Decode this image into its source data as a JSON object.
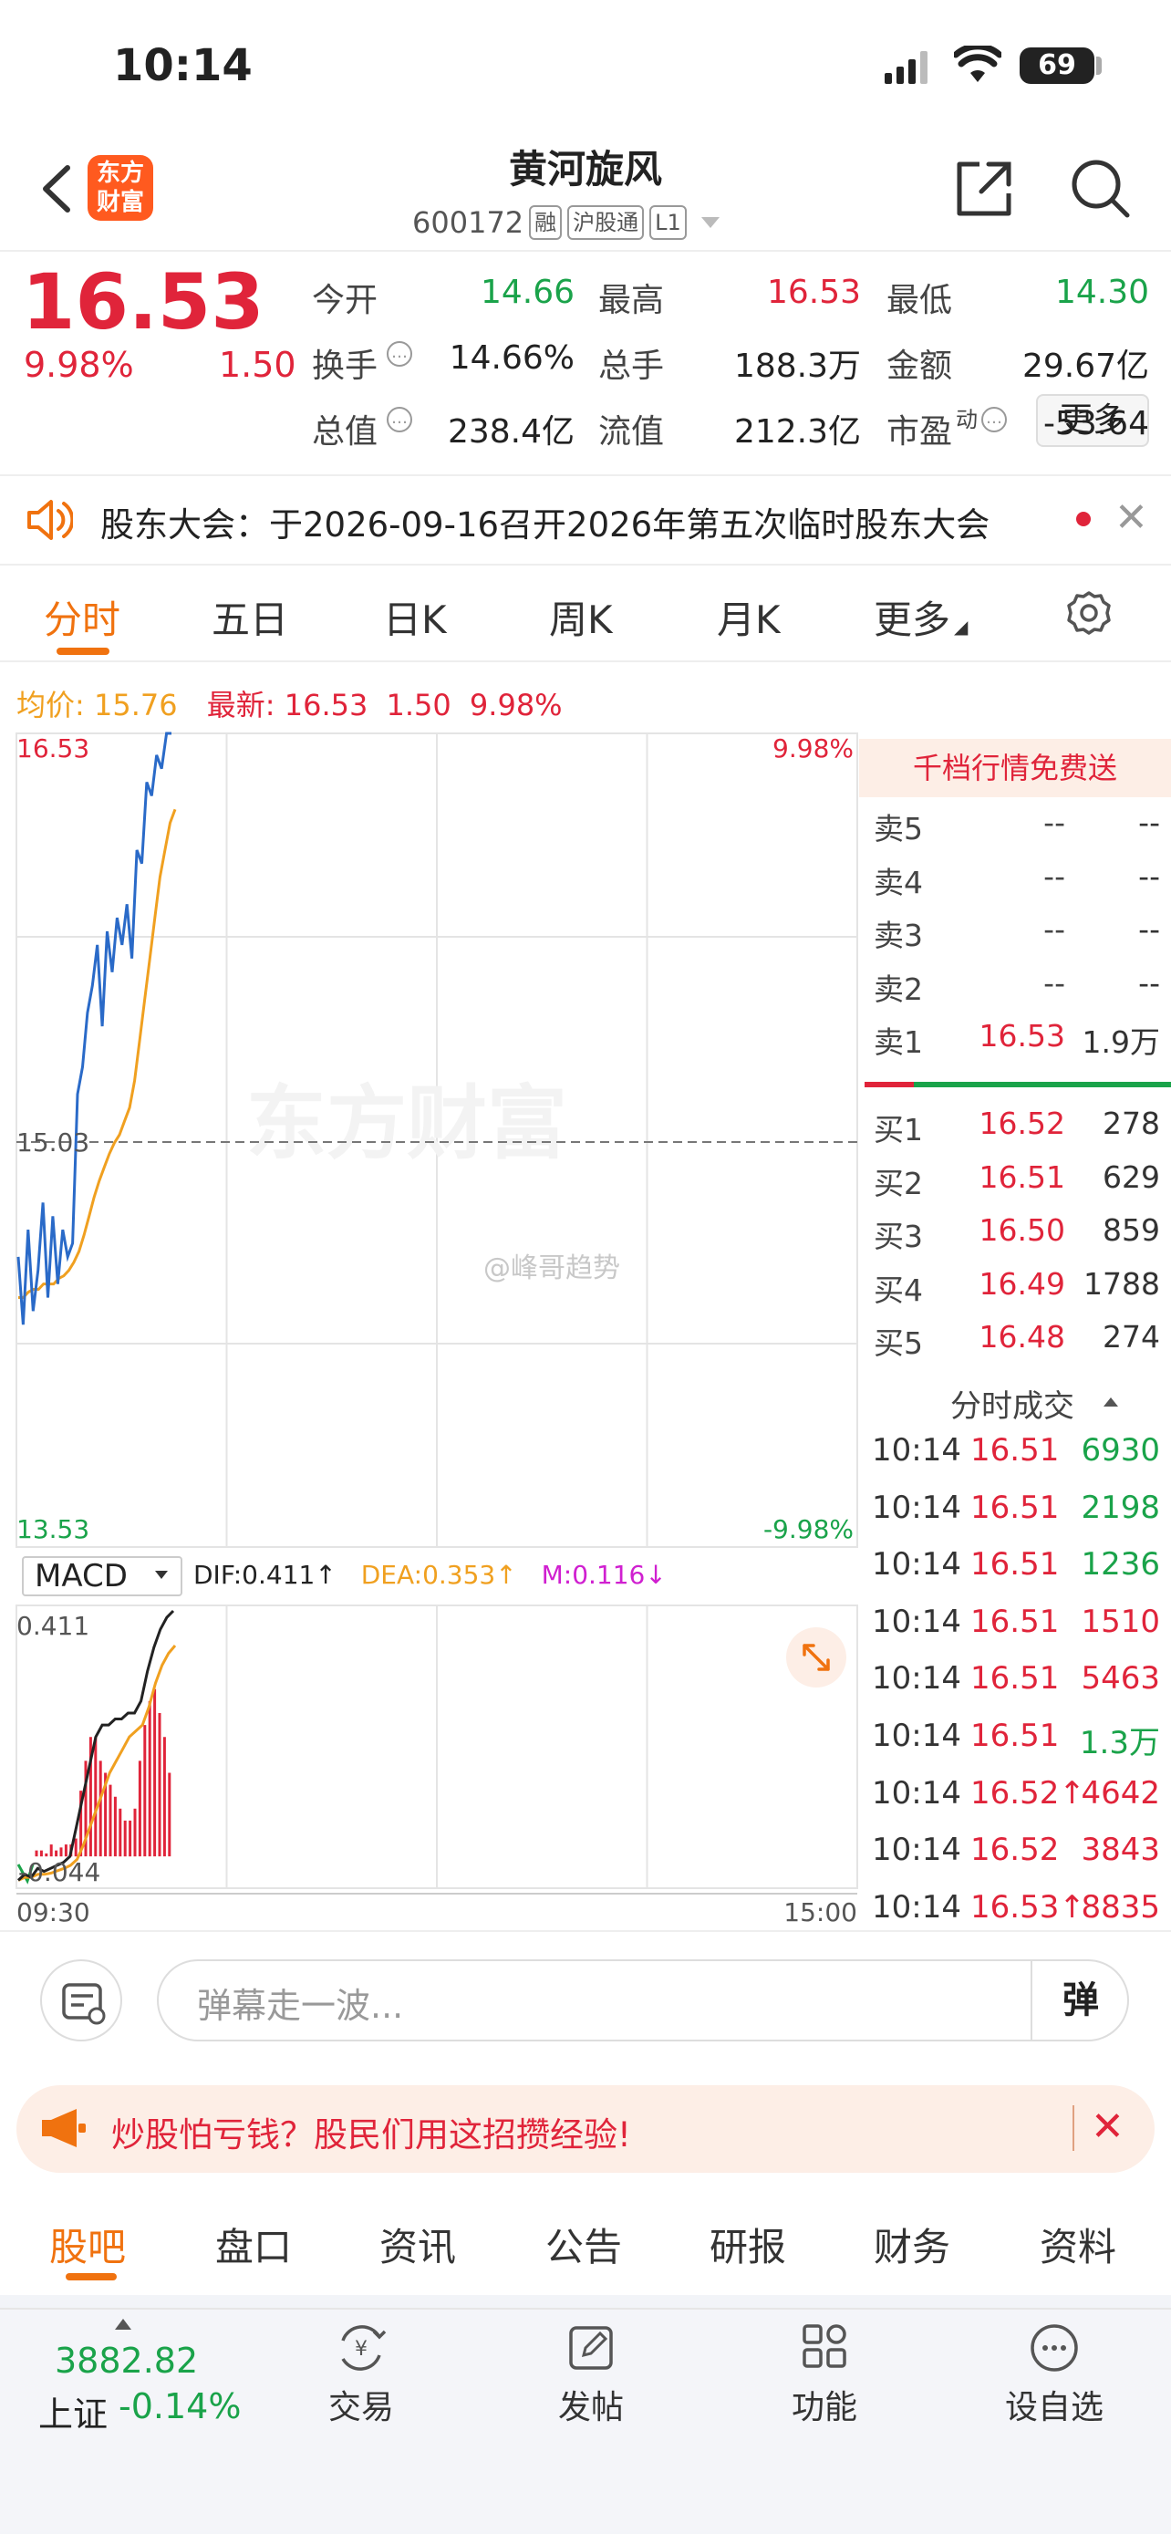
{
  "status": {
    "time": "10:14",
    "battery": "69"
  },
  "header": {
    "logo_line1": "东方",
    "logo_line2": "财富",
    "name": "黄河旋风",
    "code": "600172",
    "tags": [
      "融",
      "沪股通",
      "L1"
    ]
  },
  "quote": {
    "price": "16.53",
    "change_pct": "9.98%",
    "change": "1.50",
    "rows": [
      [
        {
          "label": "今开",
          "value": "14.66",
          "color": "green"
        },
        {
          "label": "最高",
          "value": "16.53",
          "color": "red"
        },
        {
          "label": "最低",
          "value": "14.30",
          "color": "green"
        }
      ],
      [
        {
          "label": "换手",
          "value": "14.66%",
          "color": "dark",
          "info": true
        },
        {
          "label": "总手",
          "value": "188.3万",
          "color": "dark"
        },
        {
          "label": "金额",
          "value": "29.67亿",
          "color": "dark"
        }
      ],
      [
        {
          "label": "总值",
          "value": "238.4亿",
          "color": "dark",
          "info": true
        },
        {
          "label": "流值",
          "value": "212.3亿",
          "color": "dark"
        },
        {
          "label": "市盈",
          "sup": "动",
          "value": "-53.64",
          "color": "dark",
          "info": true
        }
      ]
    ],
    "more_label": "更多"
  },
  "notice": {
    "text": "股东大会：于2026-09-16召开2026年第五次临时股东大会"
  },
  "tabs": [
    "分时",
    "五日",
    "日K",
    "周K",
    "月K",
    "更多"
  ],
  "summary": {
    "avg_label": "均价:",
    "avg_value": "15.76",
    "latest_label": "最新:",
    "latest_value": "16.53",
    "latest_change": "1.50",
    "latest_pct": "9.98%"
  },
  "chart_data": {
    "type": "line",
    "y_top": "16.53",
    "y_mid": "15.03",
    "y_bottom": "13.53",
    "pct_top": "9.98%",
    "pct_bottom": "-9.98%",
    "x_start": "09:30",
    "x_end": "15:00",
    "watermark": "东方财富",
    "weibo_mark": "@峰哥趋势",
    "price_series": [
      14.6,
      14.35,
      14.7,
      14.4,
      14.55,
      14.8,
      14.45,
      14.75,
      14.5,
      14.7,
      14.6,
      14.65,
      15.2,
      15.3,
      15.5,
      15.6,
      15.75,
      15.45,
      15.8,
      15.65,
      15.85,
      15.75,
      15.9,
      15.7,
      16.1,
      16.05,
      16.35,
      16.3,
      16.45,
      16.4,
      16.53,
      16.53
    ],
    "avg_series": [
      14.45,
      14.45,
      14.47,
      14.48,
      14.48,
      14.5,
      14.5,
      14.5,
      14.52,
      14.53,
      14.55,
      14.58,
      14.62,
      14.68,
      14.75,
      14.82,
      14.88,
      14.93,
      14.98,
      15.02,
      15.05,
      15.1,
      15.15,
      15.25,
      15.4,
      15.55,
      15.7,
      15.85,
      16.0,
      16.1,
      16.2,
      16.25
    ],
    "macd": {
      "select_label": "MACD",
      "dif": "DIF:0.411",
      "dea": "DEA:0.353",
      "m": "M:0.116",
      "y_top": "0.411",
      "y_bottom": "-0.044",
      "dif_series": [
        -0.04,
        -0.03,
        -0.035,
        -0.02,
        -0.025,
        -0.02,
        -0.015,
        -0.01,
        0.0,
        0.05,
        0.1,
        0.15,
        0.2,
        0.22,
        0.22,
        0.23,
        0.23,
        0.24,
        0.24,
        0.26,
        0.31,
        0.35,
        0.38,
        0.4,
        0.411
      ],
      "dea_series": [
        -0.04,
        -0.035,
        -0.035,
        -0.03,
        -0.03,
        -0.028,
        -0.024,
        -0.02,
        -0.015,
        -0.005,
        0.02,
        0.05,
        0.08,
        0.11,
        0.14,
        0.16,
        0.18,
        0.2,
        0.21,
        0.22,
        0.25,
        0.29,
        0.32,
        0.34,
        0.353
      ],
      "bar_series": [
        0.01,
        0.01,
        0.005,
        0.02,
        0.01,
        0.015,
        0.02,
        0.02,
        0.03,
        0.11,
        0.16,
        0.2,
        0.2,
        0.16,
        0.14,
        0.12,
        0.1,
        0.08,
        0.06,
        0.06,
        0.08,
        0.16,
        0.22,
        0.26,
        0.28,
        0.24,
        0.2,
        0.14
      ]
    }
  },
  "order_book": {
    "banner": "千档行情免费送",
    "asks": [
      {
        "label": "卖5",
        "price": "--",
        "vol": "--"
      },
      {
        "label": "卖4",
        "price": "--",
        "vol": "--"
      },
      {
        "label": "卖3",
        "price": "--",
        "vol": "--"
      },
      {
        "label": "卖2",
        "price": "--",
        "vol": "--"
      },
      {
        "label": "卖1",
        "price": "16.53",
        "vol": "1.9万"
      }
    ],
    "bids": [
      {
        "label": "买1",
        "price": "16.52",
        "vol": "278"
      },
      {
        "label": "买2",
        "price": "16.51",
        "vol": "629"
      },
      {
        "label": "买3",
        "price": "16.50",
        "vol": "859"
      },
      {
        "label": "买4",
        "price": "16.49",
        "vol": "1788"
      },
      {
        "label": "买5",
        "price": "16.48",
        "vol": "274"
      }
    ]
  },
  "ticks": {
    "title": "分时成交",
    "rows": [
      {
        "time": "10:14",
        "price": "16.51",
        "vol": "6930",
        "color": "green"
      },
      {
        "time": "10:14",
        "price": "16.51",
        "vol": "2198",
        "color": "green"
      },
      {
        "time": "10:14",
        "price": "16.51",
        "vol": "1236",
        "color": "green"
      },
      {
        "time": "10:14",
        "price": "16.51",
        "vol": "1510",
        "color": "red"
      },
      {
        "time": "10:14",
        "price": "16.51",
        "vol": "5463",
        "color": "red"
      },
      {
        "time": "10:14",
        "price": "16.51",
        "vol": "1.3万",
        "color": "green"
      },
      {
        "time": "10:14",
        "price": "16.52↑",
        "vol": "4642",
        "color": "red"
      },
      {
        "time": "10:14",
        "price": "16.52",
        "vol": "3843",
        "color": "red"
      },
      {
        "time": "10:14",
        "price": "16.53↑",
        "vol": "8835",
        "color": "red"
      }
    ]
  },
  "danmaku": {
    "placeholder": "弹幕走一波...",
    "send_label": "弹"
  },
  "ad": {
    "text": "炒股怕亏钱？股民们用这招攒经验!"
  },
  "bottom_tabs": [
    "股吧",
    "盘口",
    "资讯",
    "公告",
    "研报",
    "财务",
    "资料"
  ],
  "nav": {
    "index_value": "3882.82",
    "index_name": "上证",
    "index_pct": "-0.14%",
    "items": [
      "交易",
      "发帖",
      "功能",
      "设自选"
    ]
  },
  "colors": {
    "red": "#e0243a",
    "green": "#1aa34a",
    "accent": "#f0720f",
    "price_line": "#2a6ac8",
    "avg_line": "#f0a020"
  }
}
